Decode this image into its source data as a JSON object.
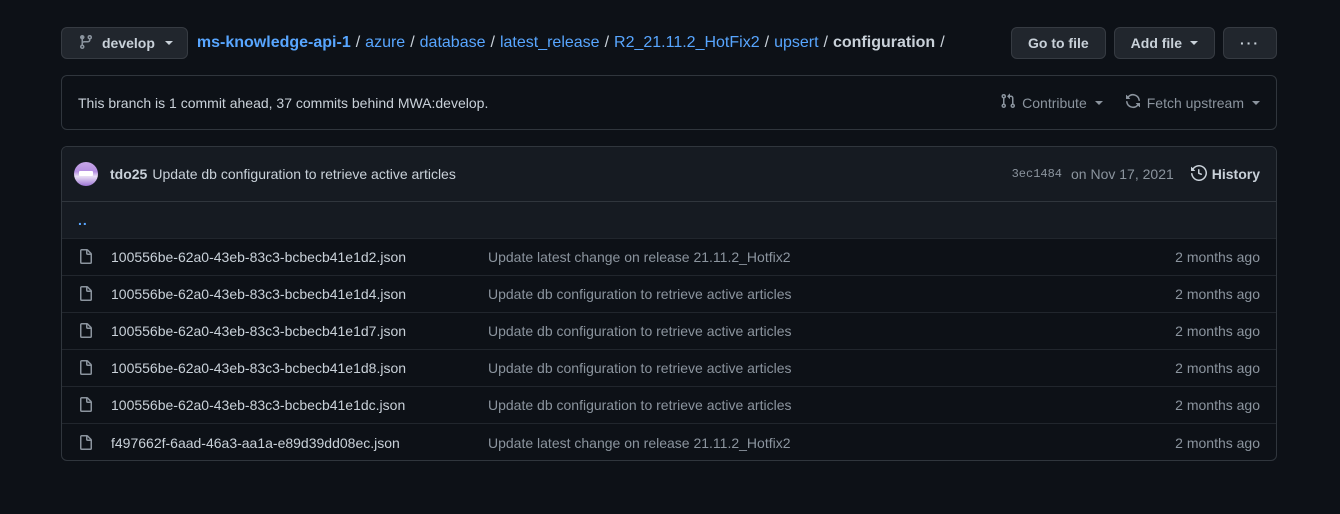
{
  "branch": {
    "label": "develop"
  },
  "breadcrumb": {
    "repo": "ms-knowledge-api-1",
    "path": [
      "azure",
      "database",
      "latest_release",
      "R2_21.11.2_HotFix2",
      "upsert"
    ],
    "current": "configuration",
    "separator": "/"
  },
  "actions": {
    "go_to_file": "Go to file",
    "add_file": "Add file",
    "more": "···"
  },
  "branch_info": {
    "text": "This branch is 1 commit ahead, 37 commits behind MWA:develop.",
    "contribute": "Contribute",
    "fetch_upstream": "Fetch upstream"
  },
  "commit": {
    "author": "tdo25",
    "message": "Update db configuration to retrieve active articles",
    "sha": "3ec1484",
    "date": "on Nov 17, 2021",
    "history": "History"
  },
  "parent_dir": "..",
  "files": [
    {
      "name": "100556be-62a0-43eb-83c3-bcbecb41e1d2.json",
      "message": "Update latest change on release 21.11.2_Hotfix2",
      "age": "2 months ago"
    },
    {
      "name": "100556be-62a0-43eb-83c3-bcbecb41e1d4.json",
      "message": "Update db configuration to retrieve active articles",
      "age": "2 months ago"
    },
    {
      "name": "100556be-62a0-43eb-83c3-bcbecb41e1d7.json",
      "message": "Update db configuration to retrieve active articles",
      "age": "2 months ago"
    },
    {
      "name": "100556be-62a0-43eb-83c3-bcbecb41e1d8.json",
      "message": "Update db configuration to retrieve active articles",
      "age": "2 months ago"
    },
    {
      "name": "100556be-62a0-43eb-83c3-bcbecb41e1dc.json",
      "message": "Update db configuration to retrieve active articles",
      "age": "2 months ago"
    },
    {
      "name": "f497662f-6aad-46a3-aa1a-e89d39dd08ec.json",
      "message": "Update latest change on release 21.11.2_Hotfix2",
      "age": "2 months ago"
    }
  ],
  "colors": {
    "background": "#0d1117",
    "link": "#58a6ff",
    "border": "#30363d",
    "muted": "#8b949e"
  },
  "icons": {
    "branch": "git-branch-icon",
    "file": "file-icon",
    "history": "history-icon",
    "contribute": "pull-request-icon",
    "fetch": "sync-icon"
  }
}
